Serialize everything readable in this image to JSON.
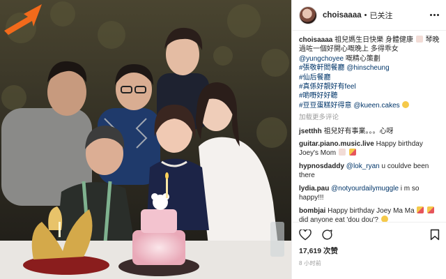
{
  "post": {
    "username": "choisaaaa",
    "follow_status": "已关注",
    "separator": "•"
  },
  "caption": {
    "author": "choisaaaa",
    "line1": "祖兒媽生日快樂 身體健康",
    "line1_tail": "琴晚",
    "line2": "過咗一個好開心嘅晚上 多得乖女",
    "mention1": "@yungchoyee",
    "line3_tail": "嘅精心策劃",
    "tag1": "#張敬軒閻餐廳",
    "mention2": "@hinscheung",
    "tag2": "#仙后餐廳",
    "tag3": "#真係好靚好有feel",
    "tag4": "#啲嘢好好聽",
    "tag5": "#豆豆蛋糕好得意",
    "mention3": "@kueen.cakes"
  },
  "load_more": "加载更多评论",
  "comments": [
    {
      "user": "jsetthh",
      "text": "祖兒好有事業。。。心呀"
    },
    {
      "user": "guitar.piano.music.live",
      "text": "Happy birthday Joey's Mom"
    },
    {
      "user": "hypnosdaddy",
      "mention": "@lok_ryan",
      "text": "u couldve been there"
    },
    {
      "user": "lydia.pau",
      "mention": "@notyourdailymuggle",
      "text": "i m so happy!!!"
    },
    {
      "user": "bombjai",
      "text": "Happy birthday Joey Ma Ma",
      "text2": "did anyone eat 'dou dou'?"
    }
  ],
  "likes": "17,619 次赞",
  "date": "8 小时前",
  "icons": {
    "more": "more-options-icon",
    "like": "heart-icon",
    "comment": "comment-icon",
    "share": "share-icon",
    "save": "bookmark-icon",
    "arrow": "orange-arrow"
  },
  "colors": {
    "arrow": "#f26a1b",
    "link": "#003569",
    "muted": "#999999"
  }
}
